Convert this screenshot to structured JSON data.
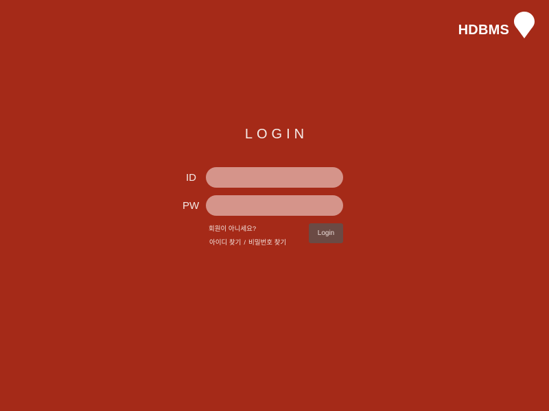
{
  "brand": {
    "name": "HDBMS",
    "icon": "map-pin-icon",
    "color": "#ffffff"
  },
  "theme": {
    "background": "#a52a18",
    "input_background": "#d5948a",
    "button_background": "#6b4a44"
  },
  "login": {
    "title": "LOGIN",
    "id_label": "ID",
    "id_value": "",
    "pw_label": "PW",
    "pw_value": "",
    "button_label": "Login",
    "not_member_text": "회원이 아니세요?",
    "find_id_text": "아이디 찾기",
    "separator": "/",
    "find_pw_text": "비밀번호 찾기"
  }
}
